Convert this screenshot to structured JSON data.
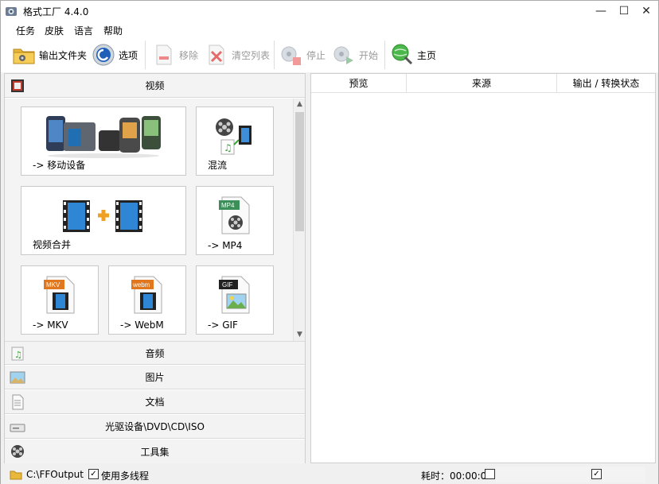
{
  "window": {
    "title": "格式工厂 4.4.0",
    "minimize": "—",
    "maximize": "☐",
    "close": "✕"
  },
  "menu": [
    "任务",
    "皮肤",
    "语言",
    "帮助"
  ],
  "toolbar": {
    "output_folder": "输出文件夹",
    "options": "选项",
    "remove": "移除",
    "clear_list": "清空列表",
    "stop": "停止",
    "start": "开始",
    "home": "主页"
  },
  "categories": {
    "video": "视频",
    "audio": "音频",
    "picture": "图片",
    "document": "文档",
    "rom": "光驱设备\\DVD\\CD\\ISO",
    "tools": "工具集"
  },
  "video_tiles": [
    {
      "label": "-> 移动设备",
      "icon": "mobile-devices-icon"
    },
    {
      "label": "混流",
      "icon": "mux-icon"
    },
    {
      "label": "视频合并",
      "icon": "video-join-icon"
    },
    {
      "label": "-> MP4",
      "icon": "mp4-icon",
      "badge": "MP4"
    },
    {
      "label": "-> MKV",
      "icon": "mkv-icon",
      "badge": "MKV"
    },
    {
      "label": "-> WebM",
      "icon": "webm-icon",
      "badge": "webm"
    },
    {
      "label": "-> GIF",
      "icon": "gif-icon",
      "badge": "GIF"
    }
  ],
  "task_columns": [
    "预览",
    "来源",
    "输出 / 转换状态"
  ],
  "statusbar": {
    "output_path": "C:\\FFOutput",
    "multithread_label": "使用多线程",
    "elapsed_label": "耗时：00:00:00"
  },
  "colors": {
    "accent_green": "#3aa53a",
    "tile_border": "#c9c9c9",
    "film_blue": "#1f6fb2"
  }
}
